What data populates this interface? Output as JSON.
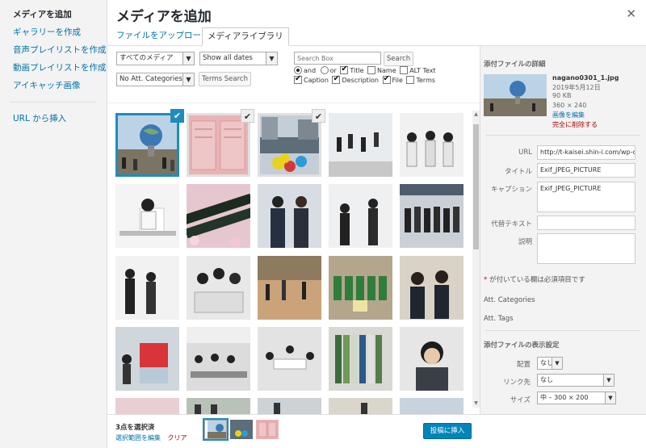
{
  "sidebar": {
    "items": [
      {
        "label": "メディアを追加"
      },
      {
        "label": "ギャラリーを作成"
      },
      {
        "label": "音声プレイリストを作成"
      },
      {
        "label": "動画プレイリストを作成"
      },
      {
        "label": "アイキャッチ画像"
      }
    ],
    "url_insert": "URL から挿入"
  },
  "header": {
    "title": "メディアを追加",
    "close_icon": "close-icon",
    "tabs": [
      {
        "label": "ファイルをアップロード",
        "active": false
      },
      {
        "label": "メディアライブラリ",
        "active": true
      }
    ]
  },
  "filters": {
    "media_type": "すべてのメディア",
    "dates": "Show all dates",
    "att_categories": "No Att. Categories",
    "terms_search": "Terms Search",
    "search_placeholder": "Search Box",
    "search_button": "Search",
    "opt_and": "and",
    "opt_or": "or",
    "opt_title": "Title",
    "opt_name": "Name",
    "opt_alt": "ALT Text",
    "opt_caption": "Caption",
    "opt_description": "Description",
    "opt_file": "File",
    "opt_terms": "Terms"
  },
  "details": {
    "heading": "添付ファイルの詳細",
    "filename": "nagano0301_1.jpg",
    "date": "2019年5月12日",
    "size": "90 KB",
    "dimensions": "360 × 240",
    "edit_link": "画像を編集",
    "delete_link": "完全に削除する",
    "url_label": "URL",
    "url_value": "http://t-kaisei.shin-i.com/wp-con",
    "title_label": "タイトル",
    "title_value": "Exif_JPEG_PICTURE",
    "caption_label": "キャプション",
    "caption_value": "Exif_JPEG_PICTURE",
    "alt_label": "代替テキスト",
    "alt_value": "",
    "desc_label": "説明",
    "desc_value": "",
    "required_mark": "*",
    "required_text": "が付いている欄は必須項目です",
    "att_categories": "Att. Categories",
    "att_tags": "Att. Tags",
    "display_heading": "添付ファイルの表示設定",
    "align_label": "配置",
    "align_value": "なし",
    "link_label": "リンク先",
    "link_value": "なし",
    "size_label": "サイズ",
    "size_value": "中 – 300 × 200"
  },
  "footer": {
    "count": "3点を選択済",
    "edit_selection": "選択範囲を編集",
    "clear": "クリア",
    "insert_button": "投稿に挿入"
  },
  "colors": {
    "accent": "#0073aa",
    "selected_outline": "#1e8cbe",
    "insert_button": "#0085ba",
    "danger": "#a00"
  }
}
